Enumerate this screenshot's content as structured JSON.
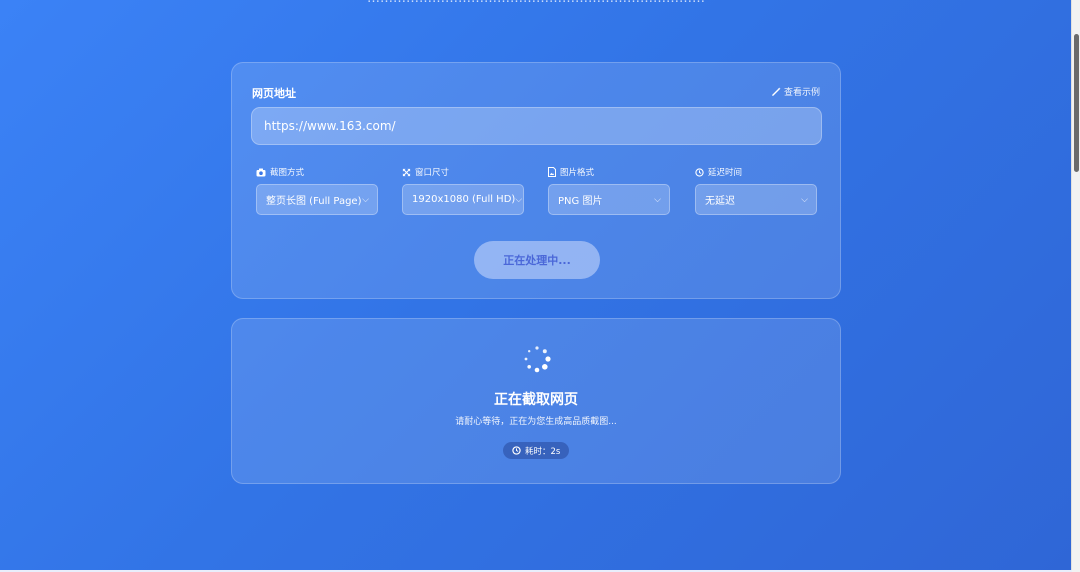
{
  "page": {
    "clipped_header_text": "……………………………………………………………………"
  },
  "form": {
    "url_label": "网页地址",
    "example_link": "查看示例",
    "url_value": "https://www.163.com/",
    "options": [
      {
        "label": "截图方式",
        "icon": "camera-icon",
        "value": "整页长图 (Full Page)"
      },
      {
        "label": "窗口尺寸",
        "icon": "expand-icon",
        "value": "1920x1080 (Full HD)"
      },
      {
        "label": "图片格式",
        "icon": "image-file-icon",
        "value": "PNG 图片"
      },
      {
        "label": "延迟时间",
        "icon": "clock-icon",
        "value": "无延迟"
      }
    ],
    "submit_label": "正在处理中..."
  },
  "status": {
    "title": "正在截取网页",
    "subtitle": "请耐心等待，正在为您生成高品质截图...",
    "timer_prefix": "耗时：",
    "timer_value": "2s",
    "timer_text": "耗时：2s"
  },
  "colors": {
    "background_start": "#3b82f6",
    "background_end": "#2f66d6",
    "button_text": "#4a67d8"
  }
}
